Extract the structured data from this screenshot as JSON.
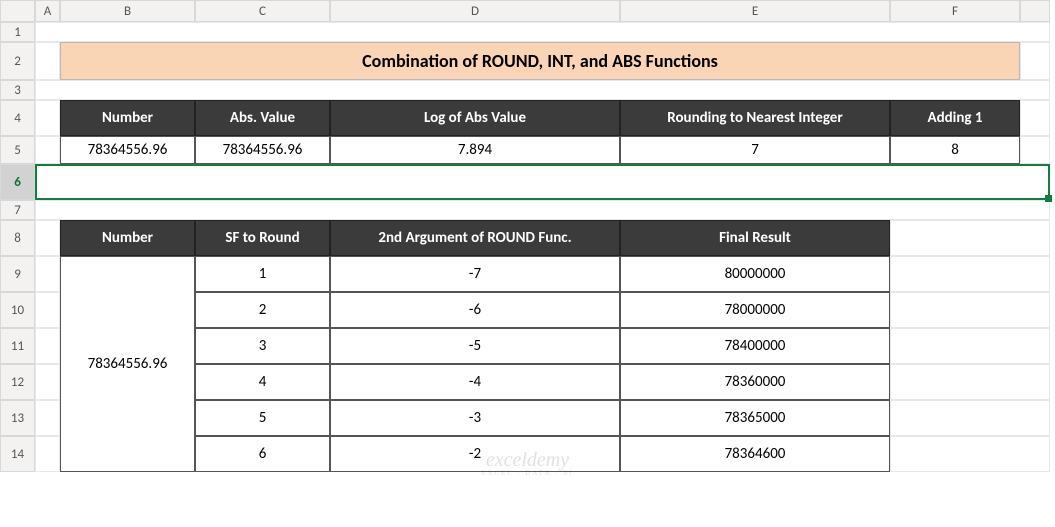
{
  "columns": [
    "A",
    "B",
    "C",
    "D",
    "E",
    "F",
    ""
  ],
  "rows": [
    "1",
    "2",
    "3",
    "4",
    "5",
    "6",
    "7",
    "8",
    "9",
    "10",
    "11",
    "12",
    "13",
    "14"
  ],
  "title": "Combination of ROUND, INT, and ABS Functions",
  "table1": {
    "headers": {
      "number": "Number",
      "abs_value": "Abs. Value",
      "log_abs": "Log of Abs Value",
      "rounding": "Rounding to Nearest Integer",
      "adding1": "Adding 1"
    },
    "row": {
      "number": "78364556.96",
      "abs_value": "78364556.96",
      "log_abs": "7.894",
      "rounding": "7",
      "adding1": "8"
    }
  },
  "table2": {
    "headers": {
      "number": "Number",
      "sf": "SF to Round",
      "arg2": "2nd Argument of ROUND Func.",
      "result": "Final Result"
    },
    "number_merged": "78364556.96",
    "rows": [
      {
        "sf": "1",
        "arg2": "-7",
        "result": "80000000"
      },
      {
        "sf": "2",
        "arg2": "-6",
        "result": "78000000"
      },
      {
        "sf": "3",
        "arg2": "-5",
        "result": "78400000"
      },
      {
        "sf": "4",
        "arg2": "-4",
        "result": "78360000"
      },
      {
        "sf": "5",
        "arg2": "-3",
        "result": "78365000"
      },
      {
        "sf": "6",
        "arg2": "-2",
        "result": "78364600"
      }
    ]
  },
  "watermark": {
    "main": "exceldemy",
    "sub": "EXCEL · DATA · BI"
  },
  "selected_row": "6"
}
